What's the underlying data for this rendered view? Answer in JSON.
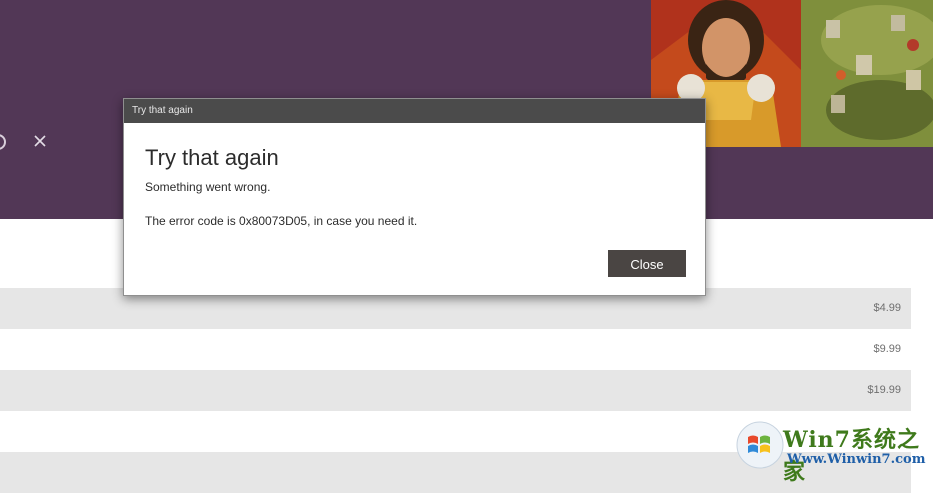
{
  "dialog": {
    "titlebar": "Try that again",
    "heading": "Try that again",
    "message": "Something went wrong.",
    "error": "The error code is 0x80073D05, in case you need it.",
    "close_label": "Close"
  },
  "prices": [
    "$4.99",
    "$9.99",
    "$19.99",
    "",
    ""
  ],
  "watermark": {
    "brand": "Win7系统之家",
    "url": "Www.Winwin7.com"
  },
  "colors": {
    "header": "#523756",
    "button": "#4a4543",
    "titlebar": "#4b4b4b"
  },
  "icons": [
    "close-icon",
    "circle-icon"
  ]
}
